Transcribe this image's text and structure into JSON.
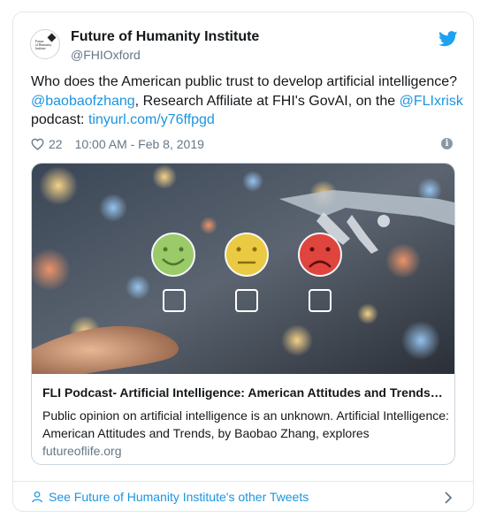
{
  "account": {
    "name": "Future of Humanity Institute",
    "handle": "@FHIOxford",
    "avatar_text": "Future of Humanity Institute"
  },
  "tweet": {
    "text_intro": "Who does the American public trust to develop artificial intelligence? ",
    "mention1": "@baobaofzhang",
    "text_mid": ", Research Affiliate at FHI's GovAI, on the ",
    "mention2": "@FLIxrisk",
    "text_after": " podcast: ",
    "url": "tinyurl.com/y76ffpgd",
    "likes": "22",
    "timestamp": "10:00 AM - Feb 8, 2019"
  },
  "link_card": {
    "title": "FLI Podcast- Artificial Intelligence: American Attitudes and Trends…",
    "description": "Public opinion on artificial intelligence is an unknown. Artificial Intelligence: American Attitudes and Trends, by Baobao Zhang, explores",
    "domain": "futureoflife.org"
  },
  "footer": {
    "label": "See Future of Humanity Institute's other Tweets"
  },
  "colors": {
    "link": "#1b95e0",
    "secondary_text": "#657786",
    "border": "#e1e8ed",
    "twitter_blue": "#1da1f2"
  },
  "icons": [
    "twitter-bird-icon",
    "heart-icon",
    "info-icon",
    "person-icon",
    "chevron-right-icon"
  ]
}
